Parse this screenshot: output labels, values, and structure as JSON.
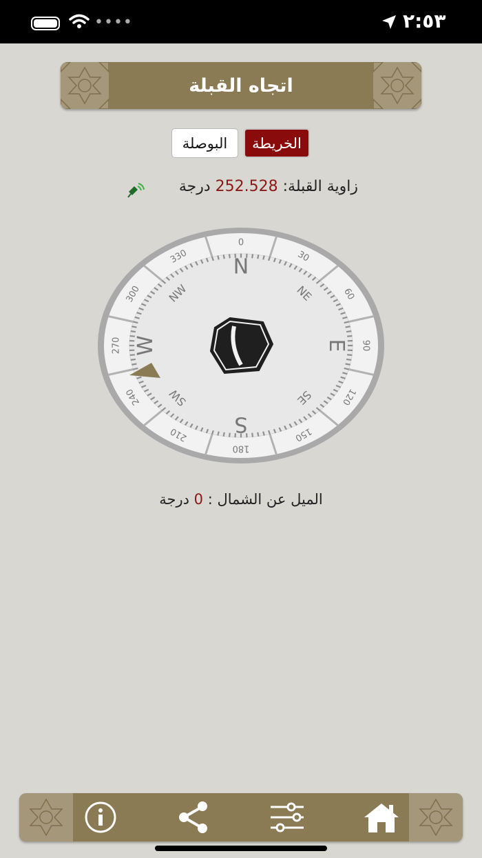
{
  "status_bar": {
    "time": "٢:٥٣"
  },
  "header": {
    "title": "اتجاه القبلة"
  },
  "tabs": {
    "map": "الخريطة",
    "compass": "البوصلة",
    "active": "map"
  },
  "qibla": {
    "label": "زاوية القبلة:",
    "value": "252.528",
    "unit": "درجة"
  },
  "compass": {
    "cardinals": [
      "N",
      "E",
      "S",
      "W"
    ],
    "intercardinals": [
      "NE",
      "SE",
      "SW",
      "NW"
    ],
    "degree_labels": [
      "0",
      "30",
      "60",
      "90",
      "120",
      "150",
      "180",
      "210",
      "240",
      "270",
      "300",
      "330"
    ]
  },
  "declination": {
    "label": "الميل عن الشمال :",
    "value": "0",
    "unit": "درجة"
  },
  "colors": {
    "accent_red": "#8a0b0b",
    "banner_gold": "#8b7b55",
    "background": "#d8d7d2"
  },
  "nav": {
    "icons": [
      "info-icon",
      "share-icon",
      "settings-sliders-icon",
      "home-icon"
    ]
  }
}
